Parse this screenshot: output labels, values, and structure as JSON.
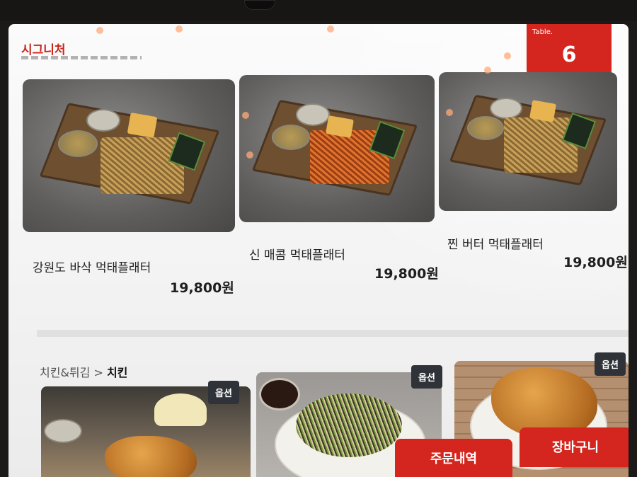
{
  "header": {
    "section_title": "시그니처",
    "table_label": "Table.",
    "table_number": "6"
  },
  "signature_menu": {
    "items": [
      {
        "name": "강원도 바삭 먹태플래터",
        "price": "19,800원"
      },
      {
        "name": "신 매콤 먹태플래터",
        "price": "19,800원"
      },
      {
        "name": "찐 버터 먹태플래터",
        "price": "19,800원"
      }
    ]
  },
  "chicken_section": {
    "breadcrumb_parent": "치킨&튀김",
    "breadcrumb_separator": ">",
    "breadcrumb_current": "치킨",
    "option_badge": "옵션"
  },
  "actions": {
    "order_history": "주문내역",
    "cart": "장바구니"
  },
  "colors": {
    "accent_red": "#d4261e",
    "badge_dark": "#2f3238"
  }
}
